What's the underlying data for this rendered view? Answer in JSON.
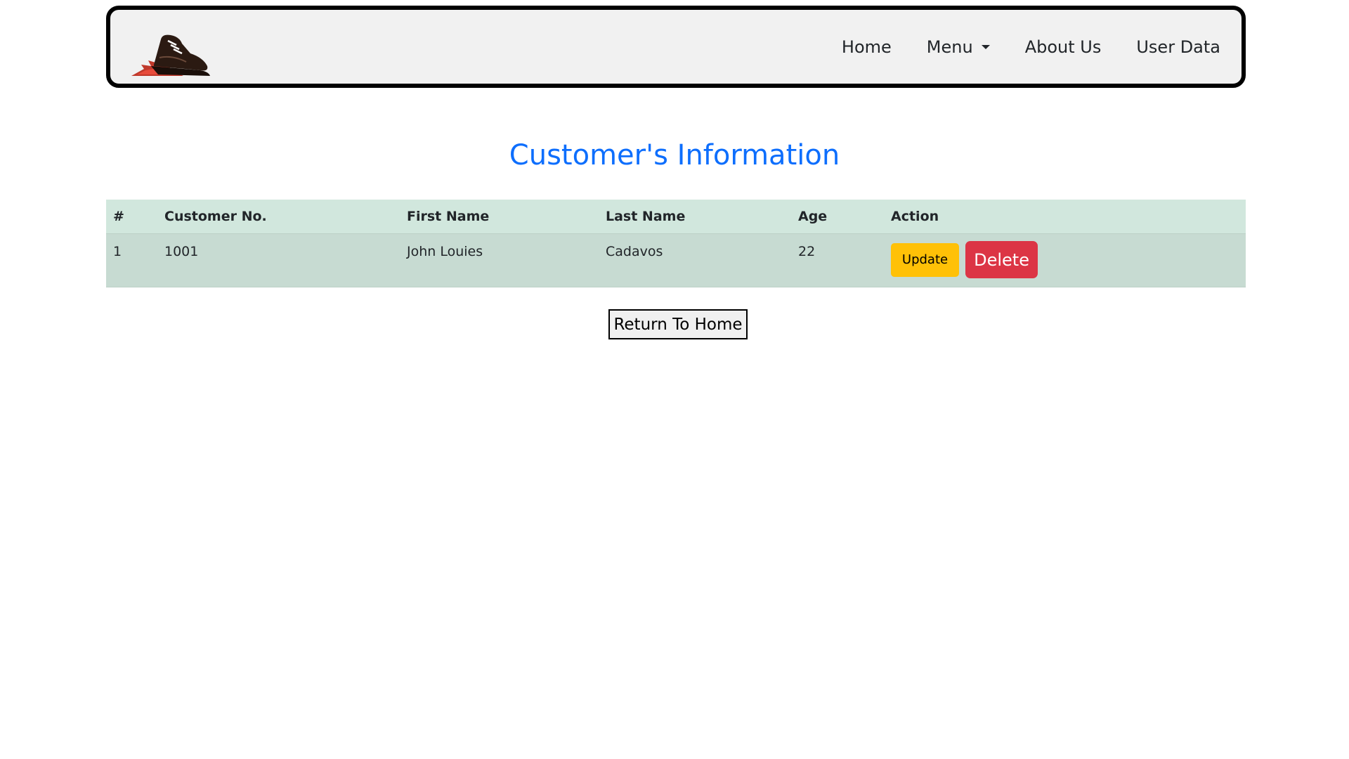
{
  "navbar": {
    "logo_icon": "running-shoe-logo",
    "links": [
      {
        "label": "Home"
      },
      {
        "label": "Menu",
        "has_dropdown": true
      },
      {
        "label": "About Us"
      },
      {
        "label": "User Data"
      }
    ]
  },
  "page": {
    "title": "Customer's Information"
  },
  "table": {
    "headers": {
      "index": "#",
      "customer_no": "Customer No.",
      "first_name": "First Name",
      "last_name": "Last Name",
      "age": "Age",
      "action": "Action"
    },
    "rows": [
      {
        "index": "1",
        "customer_no": "1001",
        "first_name": "John Louies",
        "last_name": "Cadavos",
        "age": "22",
        "update_label": "Update",
        "delete_label": "Delete"
      }
    ]
  },
  "footer": {
    "return_label": "Return To Home"
  },
  "colors": {
    "title": "#0d6efd",
    "header_row": "#d1e7dd",
    "update_button": "#ffc107",
    "delete_button": "#dc3545",
    "navbar_bg": "#f1f1f1"
  }
}
